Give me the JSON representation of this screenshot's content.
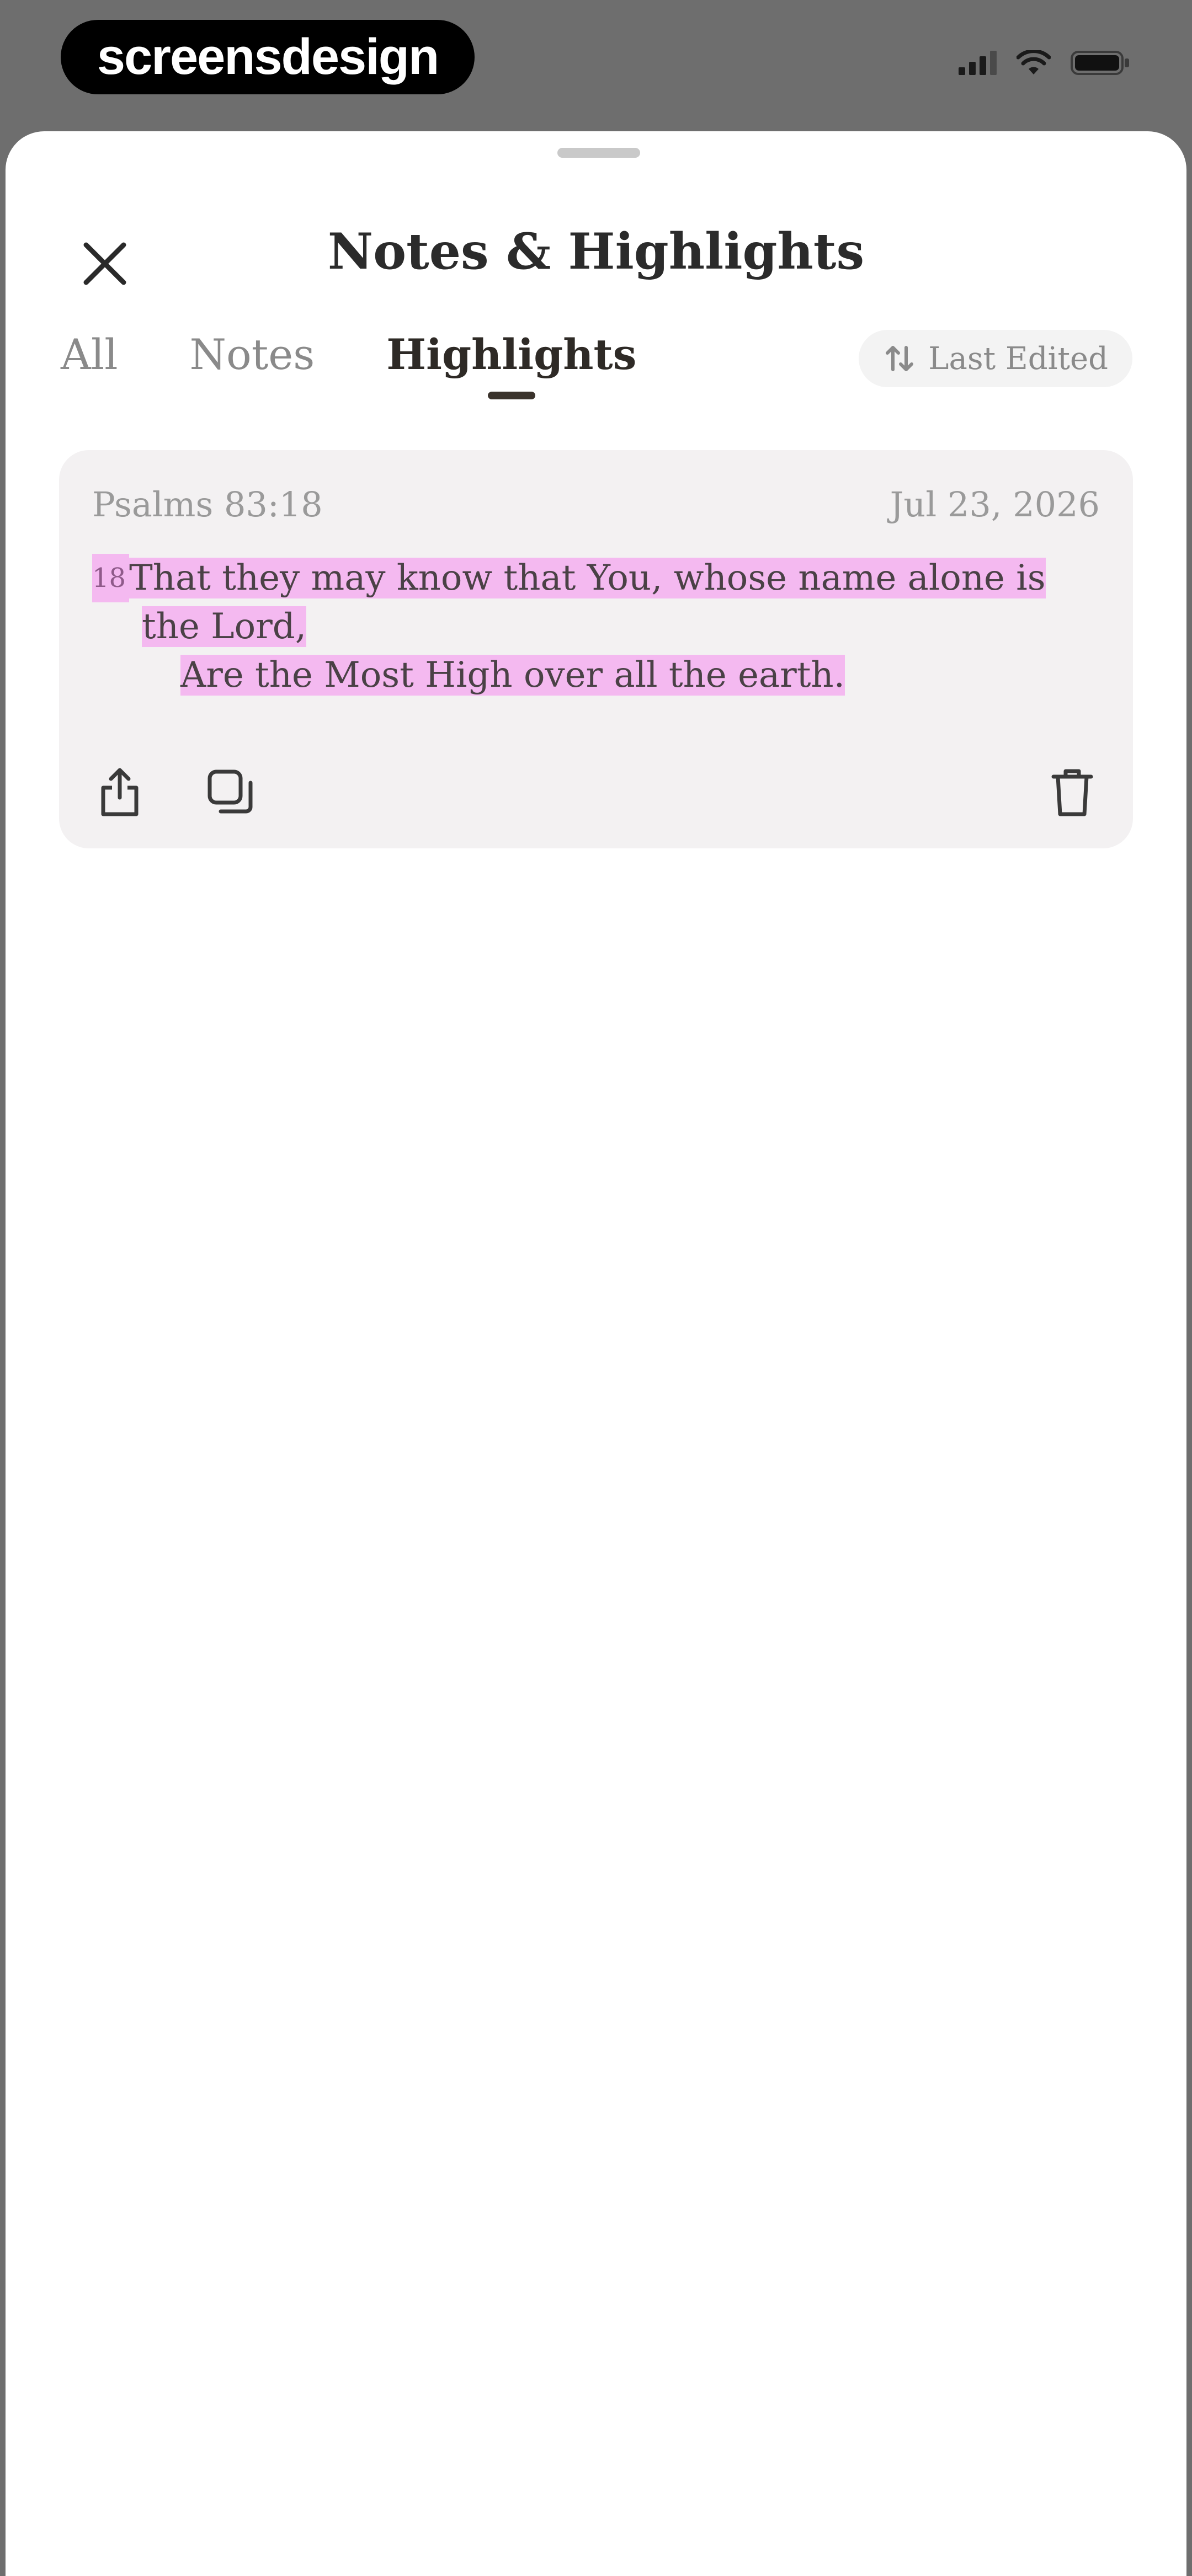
{
  "status_bar": {
    "brand": "screensdesign"
  },
  "sheet": {
    "title": "Notes & Highlights"
  },
  "tabs": [
    {
      "label": "All",
      "active": false
    },
    {
      "label": "Notes",
      "active": false
    },
    {
      "label": "Highlights",
      "active": true
    }
  ],
  "sort": {
    "label": "Last Edited"
  },
  "highlights": [
    {
      "reference": "Psalms 83:18",
      "date": "Jul 23, 2026",
      "verse_number": "18",
      "lines": [
        "That they may know that You, whose name alone is",
        "the Lord,",
        "Are the Most High over all the earth."
      ],
      "highlight_color": "#f4b9f0"
    }
  ],
  "icons": {
    "close": "close-icon",
    "sort": "sort-arrows-icon",
    "share": "share-icon",
    "copy": "copy-icon",
    "delete": "trash-icon"
  }
}
